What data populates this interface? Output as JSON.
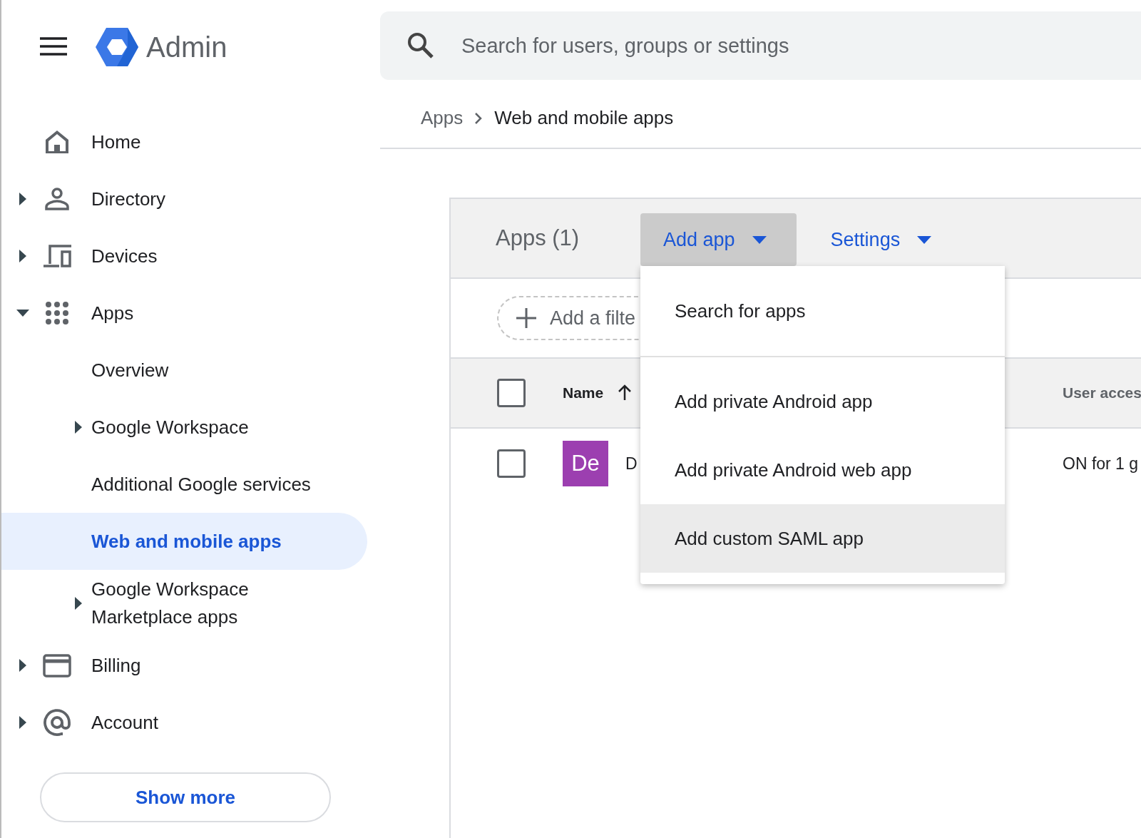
{
  "header": {
    "app_name": "Admin"
  },
  "search": {
    "placeholder": "Search for users, groups or settings"
  },
  "breadcrumb": [
    "Apps",
    "Web and mobile apps"
  ],
  "sidebar": {
    "items": [
      {
        "label": "Home",
        "selected": false
      },
      {
        "label": "Directory",
        "expanded": false,
        "selected": false
      },
      {
        "label": "Devices",
        "expanded": false,
        "selected": false
      },
      {
        "label": "Apps",
        "expanded": true,
        "selected": false,
        "children": [
          {
            "label": "Overview",
            "selected": false
          },
          {
            "label": "Google Workspace",
            "expanded": false,
            "selected": false
          },
          {
            "label": "Additional Google services",
            "selected": false
          },
          {
            "label": "Web and mobile apps",
            "selected": true
          },
          {
            "label": "Google Workspace Marketplace apps",
            "expanded": false,
            "selected": false
          }
        ]
      },
      {
        "label": "Billing",
        "expanded": false,
        "selected": false
      },
      {
        "label": "Account",
        "expanded": false,
        "selected": false
      }
    ],
    "show_more": "Show more"
  },
  "card": {
    "title": "Apps (1)",
    "actions": [
      {
        "label": "Add app",
        "pressed": true
      },
      {
        "label": "Settings",
        "pressed": false
      }
    ],
    "menu": [
      {
        "label": "Search for apps",
        "selected": false
      },
      {
        "label": "Add private Android app",
        "selected": false
      },
      {
        "label": "Add private Android web app",
        "selected": false
      },
      {
        "label": "Add custom SAML app",
        "selected": true
      }
    ],
    "filter": {
      "label": "Add a filte"
    },
    "table": {
      "header_checked": false,
      "columns": [
        {
          "label": "Name",
          "sorted": true
        },
        {
          "label": "User acces"
        }
      ],
      "rows": [
        {
          "checked": false,
          "avatar": "De",
          "color": "#9c3fb0",
          "name": "D",
          "user_access": "ON for 1 g"
        }
      ]
    }
  }
}
